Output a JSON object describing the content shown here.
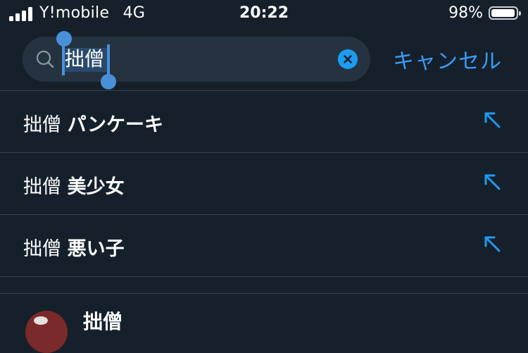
{
  "status_bar": {
    "carrier": "Y!mobile",
    "network": "4G",
    "time": "20:22",
    "battery_percent": "98%"
  },
  "search": {
    "query": "拙僧",
    "clear_icon": "clear-x-icon",
    "cancel_label": "キャンセル"
  },
  "suggestions": [
    {
      "query": "拙僧",
      "suffix": "パンケーキ",
      "icon": "arrow-up-left-icon"
    },
    {
      "query": "拙僧",
      "suffix": "美少女",
      "icon": "arrow-up-left-icon"
    },
    {
      "query": "拙僧",
      "suffix": "悪い子",
      "icon": "arrow-up-left-icon"
    }
  ],
  "user_result": {
    "name": "拙僧"
  },
  "colors": {
    "background": "#15202b",
    "accent": "#1d9bf0",
    "search_bg": "#253341",
    "divider": "#38444d"
  }
}
